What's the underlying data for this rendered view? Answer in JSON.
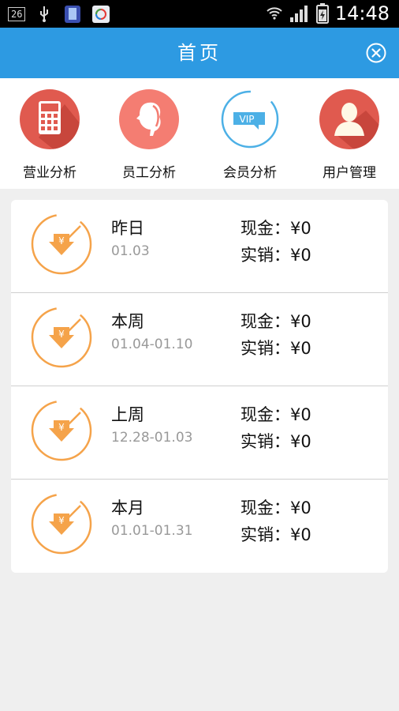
{
  "status_bar": {
    "notification_count": "26",
    "time": "14:48",
    "icons": [
      "usb-icon",
      "phone-icon",
      "app-store-icon",
      "wifi-icon",
      "signal-icon",
      "battery-icon"
    ]
  },
  "header": {
    "title": "首页",
    "close_icon": "close-circle-icon",
    "background": "#2d9ae2"
  },
  "menu": [
    {
      "label": "营业分析",
      "icon": "calculator-icon",
      "color": "#e05a4f"
    },
    {
      "label": "员工分析",
      "icon": "employee-icon",
      "color": "#f47d72"
    },
    {
      "label": "会员分析",
      "icon": "vip-icon",
      "badge": "VIP",
      "color": "#4cb0e6"
    },
    {
      "label": "用户管理",
      "icon": "user-icon",
      "color": "#e05a4f"
    }
  ],
  "summary": {
    "accent": "#f5a34a",
    "rows": [
      {
        "title": "昨日",
        "date": "01.03",
        "cash": "现金：¥0",
        "sales": "实销：¥0"
      },
      {
        "title": "本周",
        "date": "01.04-01.10",
        "cash": "现金：¥0",
        "sales": "实销：¥0"
      },
      {
        "title": "上周",
        "date": "12.28-01.03",
        "cash": "现金：¥0",
        "sales": "实销：¥0"
      },
      {
        "title": "本月",
        "date": "01.01-01.31",
        "cash": "现金：¥0",
        "sales": "实销：¥0"
      }
    ]
  }
}
